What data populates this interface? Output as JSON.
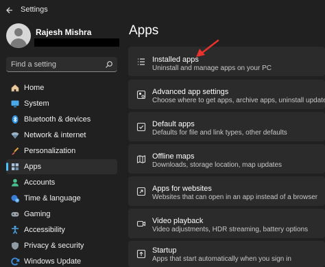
{
  "window": {
    "title": "Settings"
  },
  "user": {
    "name": "Rajesh Mishra"
  },
  "search": {
    "placeholder": "Find a setting"
  },
  "sidebar": {
    "items": [
      {
        "label": "Home",
        "icon": "home-icon"
      },
      {
        "label": "System",
        "icon": "system-icon"
      },
      {
        "label": "Bluetooth & devices",
        "icon": "bluetooth-icon"
      },
      {
        "label": "Network & internet",
        "icon": "network-icon"
      },
      {
        "label": "Personalization",
        "icon": "brush-icon"
      },
      {
        "label": "Apps",
        "icon": "apps-icon",
        "selected": true
      },
      {
        "label": "Accounts",
        "icon": "accounts-icon"
      },
      {
        "label": "Time & language",
        "icon": "globe-clock-icon"
      },
      {
        "label": "Gaming",
        "icon": "controller-icon"
      },
      {
        "label": "Accessibility",
        "icon": "accessibility-icon"
      },
      {
        "label": "Privacy & security",
        "icon": "shield-icon"
      },
      {
        "label": "Windows Update",
        "icon": "update-icon"
      }
    ]
  },
  "main": {
    "title": "Apps",
    "cards": [
      {
        "title": "Installed apps",
        "desc": "Uninstall and manage apps on your PC",
        "icon": "list-icon"
      },
      {
        "title": "Advanced app settings",
        "desc": "Choose where to get apps, archive apps, uninstall updates",
        "icon": "app-settings-icon"
      },
      {
        "title": "Default apps",
        "desc": "Defaults for file and link types, other defaults",
        "icon": "default-apps-icon"
      },
      {
        "title": "Offline maps",
        "desc": "Downloads, storage location, map updates",
        "icon": "map-icon"
      },
      {
        "title": "Apps for websites",
        "desc": "Websites that can open in an app instead of a browser",
        "icon": "web-app-icon"
      },
      {
        "title": "Video playback",
        "desc": "Video adjustments, HDR streaming, battery options",
        "icon": "video-icon"
      },
      {
        "title": "Startup",
        "desc": "Apps that start automatically when you sign in",
        "icon": "startup-icon"
      }
    ]
  },
  "colors": {
    "accent": "#4cc2ff",
    "annotation_arrow": "#e8322c",
    "background": "#202020",
    "card": "#2b2b2b"
  }
}
